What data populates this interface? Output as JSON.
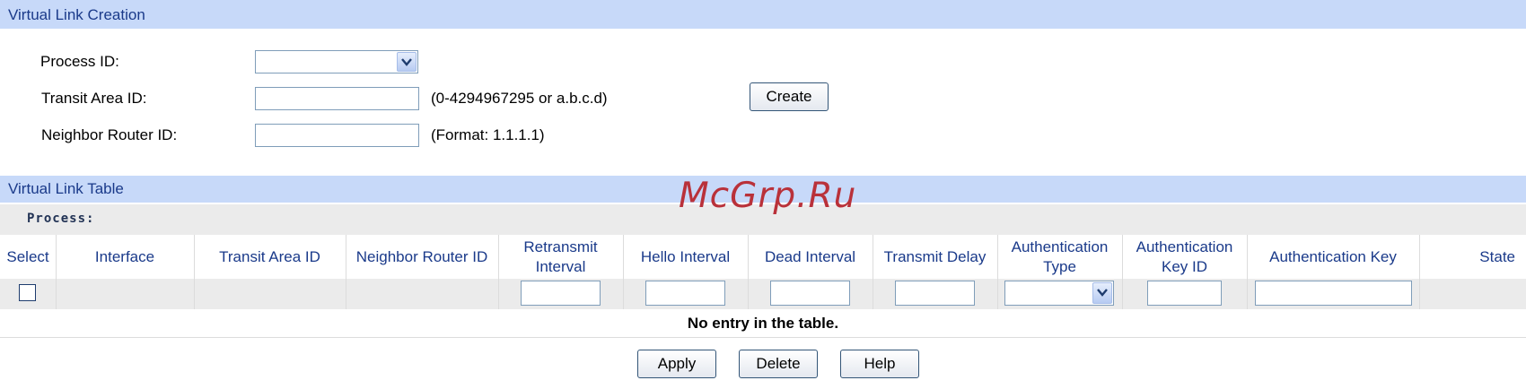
{
  "creation": {
    "title": "Virtual Link Creation",
    "process_id_label": "Process ID:",
    "process_id_value": "",
    "transit_area_label": "Transit Area ID:",
    "transit_area_value": "",
    "transit_area_hint": "(0-4294967295 or a.b.c.d)",
    "neighbor_label": "Neighbor Router ID:",
    "neighbor_value": "",
    "neighbor_hint": "(Format: 1.1.1.1)",
    "create_label": "Create"
  },
  "watermark": "McGrp.Ru",
  "table": {
    "title": "Virtual Link Table",
    "process_label": "Process:",
    "headers": {
      "select": "Select",
      "interface": "Interface",
      "transit_area": "Transit Area ID",
      "neighbor": "Neighbor Router ID",
      "retransmit_1": "Retransmit",
      "retransmit_2": "Interval",
      "hello": "Hello Interval",
      "dead": "Dead Interval",
      "delay": "Transmit Delay",
      "auth_type_1": "Authentication",
      "auth_type_2": "Type",
      "auth_key_id_1": "Authentication",
      "auth_key_id_2": "Key ID",
      "auth_key": "Authentication Key",
      "state": "State"
    },
    "edit_row": {
      "retransmit": "",
      "hello": "",
      "dead": "",
      "delay": "",
      "auth_type": "",
      "auth_key_id": "",
      "auth_key": ""
    },
    "empty_message": "No entry in the table."
  },
  "actions": {
    "apply": "Apply",
    "delete": "Delete",
    "help": "Help"
  },
  "colors": {
    "header_bg": "#c7d9f9",
    "header_text": "#1a3a8a",
    "row_bg": "#ebebeb"
  }
}
